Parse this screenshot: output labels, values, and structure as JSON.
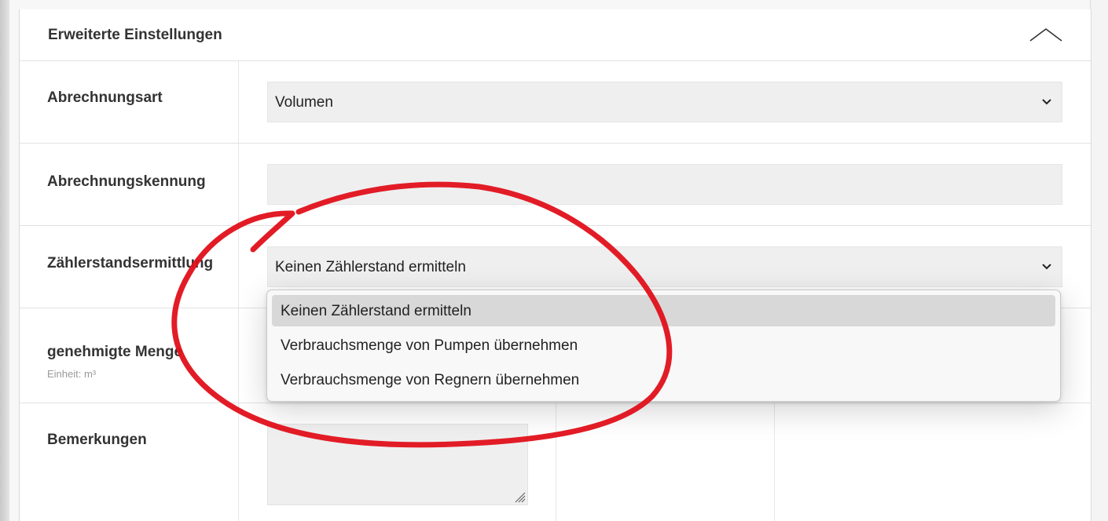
{
  "panel": {
    "title": "Erweiterte Einstellungen"
  },
  "fields": {
    "billing_type": {
      "label": "Abrechnungsart",
      "value": "Volumen"
    },
    "billing_id": {
      "label": "Abrechnungskennung",
      "value": ""
    },
    "meter_reading": {
      "label": "Zählerstandsermittlung",
      "value": "Keinen Zählerstand ermitteln",
      "options": [
        "Keinen Zählerstand ermitteln",
        "Verbrauchsmenge von Pumpen übernehmen",
        "Verbrauchsmenge von Regnern übernehmen"
      ],
      "highlighted_option": "Keinen Zählerstand ermitteln"
    },
    "approved_amount": {
      "label": "genehmigte Menge",
      "unit_label": "Einheit: m³"
    },
    "remarks": {
      "label": "Bemerkungen",
      "value": ""
    }
  },
  "icons": {
    "collapse": "chevron-up-icon",
    "select_arrow": "chevron-down-icon",
    "resize": "resize-handle-icon"
  },
  "colors": {
    "annotation": "#e0101a",
    "input_bg": "#efefef",
    "selected_option_bg": "#d8d8d8"
  }
}
